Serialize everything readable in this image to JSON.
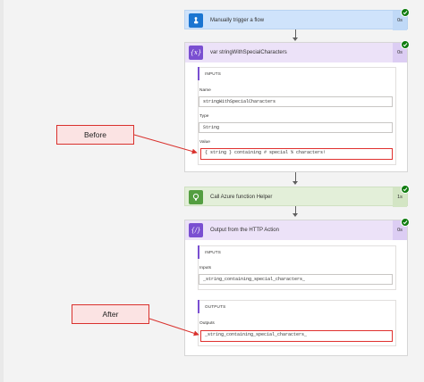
{
  "steps": [
    {
      "title": "Manually trigger a flow",
      "duration": "0s",
      "icon": "hand-touch-icon",
      "header_color": "#cfe3fb",
      "tile_color": "#1b75d1"
    },
    {
      "title": "var stringWithSpecialCharacters",
      "duration": "0s",
      "icon": "variable-icon",
      "header_color": "#ece2f8",
      "tile_color": "#7a4fd1",
      "inputs_heading": "INPUTS",
      "fields": [
        {
          "label": "Name",
          "value": "stringWithSpecialCharacters"
        },
        {
          "label": "Type",
          "value": "String"
        },
        {
          "label": "Value",
          "value": "{ string } containing # special % characters!"
        }
      ]
    },
    {
      "title": "Call Azure function Helper",
      "duration": "1s",
      "icon": "lightbulb-icon",
      "header_color": "#e3efd9",
      "tile_color": "#549e41"
    },
    {
      "title": "Output from the HTTP Action",
      "duration": "0s",
      "icon": "compose-icon",
      "header_color": "#ece2f8",
      "tile_color": "#7a4fd1",
      "inputs_heading": "INPUTS",
      "inputs_label": "Inputs",
      "inputs_value": "_string_containing_special_characters_",
      "outputs_heading": "OUTPUTS",
      "outputs_label": "Outputs",
      "outputs_value": "_string_containing_special_characters_"
    }
  ],
  "annotations": {
    "before": "Before",
    "after": "After",
    "color": "#d9312d"
  },
  "colors": {
    "success": "#107c10",
    "section_accent": "#7a4fd1",
    "highlight_border": "#e0302e"
  }
}
